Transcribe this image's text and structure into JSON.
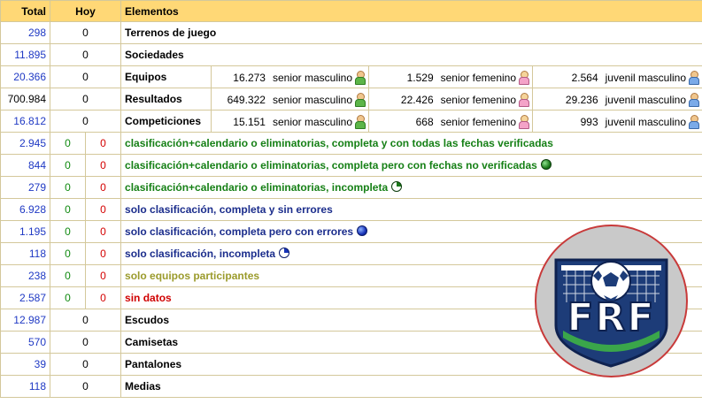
{
  "header": {
    "total": "Total",
    "hoy": "Hoy",
    "elementos": "Elementos"
  },
  "rows": {
    "terrenos": {
      "total": "298",
      "hoy": "0",
      "label": "Terrenos de juego"
    },
    "sociedades": {
      "total": "11.895",
      "hoy": "0",
      "label": "Sociedades"
    },
    "equipos": {
      "total": "20.366",
      "hoy": "0",
      "label": "Equipos",
      "sub": [
        {
          "num": "16.273",
          "cat": "senior masculino",
          "icon": "male-senior-icon"
        },
        {
          "num": "1.529",
          "cat": "senior femenino",
          "icon": "female-senior-icon"
        },
        {
          "num": "2.564",
          "cat": "juvenil masculino",
          "icon": "male-youth-icon"
        }
      ]
    },
    "resultados": {
      "total": "700.984",
      "hoy": "0",
      "label": "Resultados",
      "sub": [
        {
          "num": "649.322",
          "cat": "senior masculino",
          "icon": "male-senior-icon"
        },
        {
          "num": "22.426",
          "cat": "senior femenino",
          "icon": "female-senior-icon"
        },
        {
          "num": "29.236",
          "cat": "juvenil masculino",
          "icon": "male-youth-icon"
        }
      ]
    },
    "competiciones": {
      "total": "16.812",
      "hoy": "0",
      "label": "Competiciones",
      "sub": [
        {
          "num": "15.151",
          "cat": "senior masculino",
          "icon": "male-senior-icon"
        },
        {
          "num": "668",
          "cat": "senior femenino",
          "icon": "female-senior-icon"
        },
        {
          "num": "993",
          "cat": "juvenil masculino",
          "icon": "male-youth-icon"
        }
      ]
    },
    "status": [
      {
        "total": "2.945",
        "hoy_a": "0",
        "hoy_b": "0",
        "label": "clasificación+calendario o eliminatorias, completa y con todas las fechas verificadas",
        "icon": ""
      },
      {
        "total": "844",
        "hoy_a": "0",
        "hoy_b": "0",
        "label": "clasificación+calendario o eliminatorias, completa pero con fechas no verificadas",
        "icon": "green-full-dot-icon"
      },
      {
        "total": "279",
        "hoy_a": "0",
        "hoy_b": "0",
        "label": "clasificación+calendario o eliminatorias, incompleta",
        "icon": "green-partial-dot-icon"
      },
      {
        "total": "6.928",
        "hoy_a": "0",
        "hoy_b": "0",
        "label": "solo clasificación, completa y sin errores",
        "icon": ""
      },
      {
        "total": "1.195",
        "hoy_a": "0",
        "hoy_b": "0",
        "label": "solo clasificación, completa pero con errores",
        "icon": "blue-full-dot-icon"
      },
      {
        "total": "118",
        "hoy_a": "0",
        "hoy_b": "0",
        "label": "solo clasificación, incompleta",
        "icon": "blue-partial-dot-icon"
      },
      {
        "total": "238",
        "hoy_a": "0",
        "hoy_b": "0",
        "label": "solo equipos participantes",
        "icon": ""
      },
      {
        "total": "2.587",
        "hoy_a": "0",
        "hoy_b": "0",
        "label": "sin datos",
        "icon": ""
      }
    ],
    "escudos": {
      "total": "12.987",
      "hoy": "0",
      "label": "Escudos"
    },
    "camisetas": {
      "total": "570",
      "hoy": "0",
      "label": "Camisetas"
    },
    "pantalones": {
      "total": "39",
      "hoy": "0",
      "label": "Pantalones"
    },
    "medias": {
      "total": "118",
      "hoy": "0",
      "label": "Medias"
    }
  },
  "logo": {
    "text": "FRF",
    "icon": "soccer-ball-goal-logo"
  },
  "colors": {
    "header_bg": "#ffd876",
    "link_blue": "#1f39c4",
    "green": "#168016",
    "navy": "#1b2d8c",
    "olive": "#9b9b2c",
    "red": "#d00000"
  }
}
